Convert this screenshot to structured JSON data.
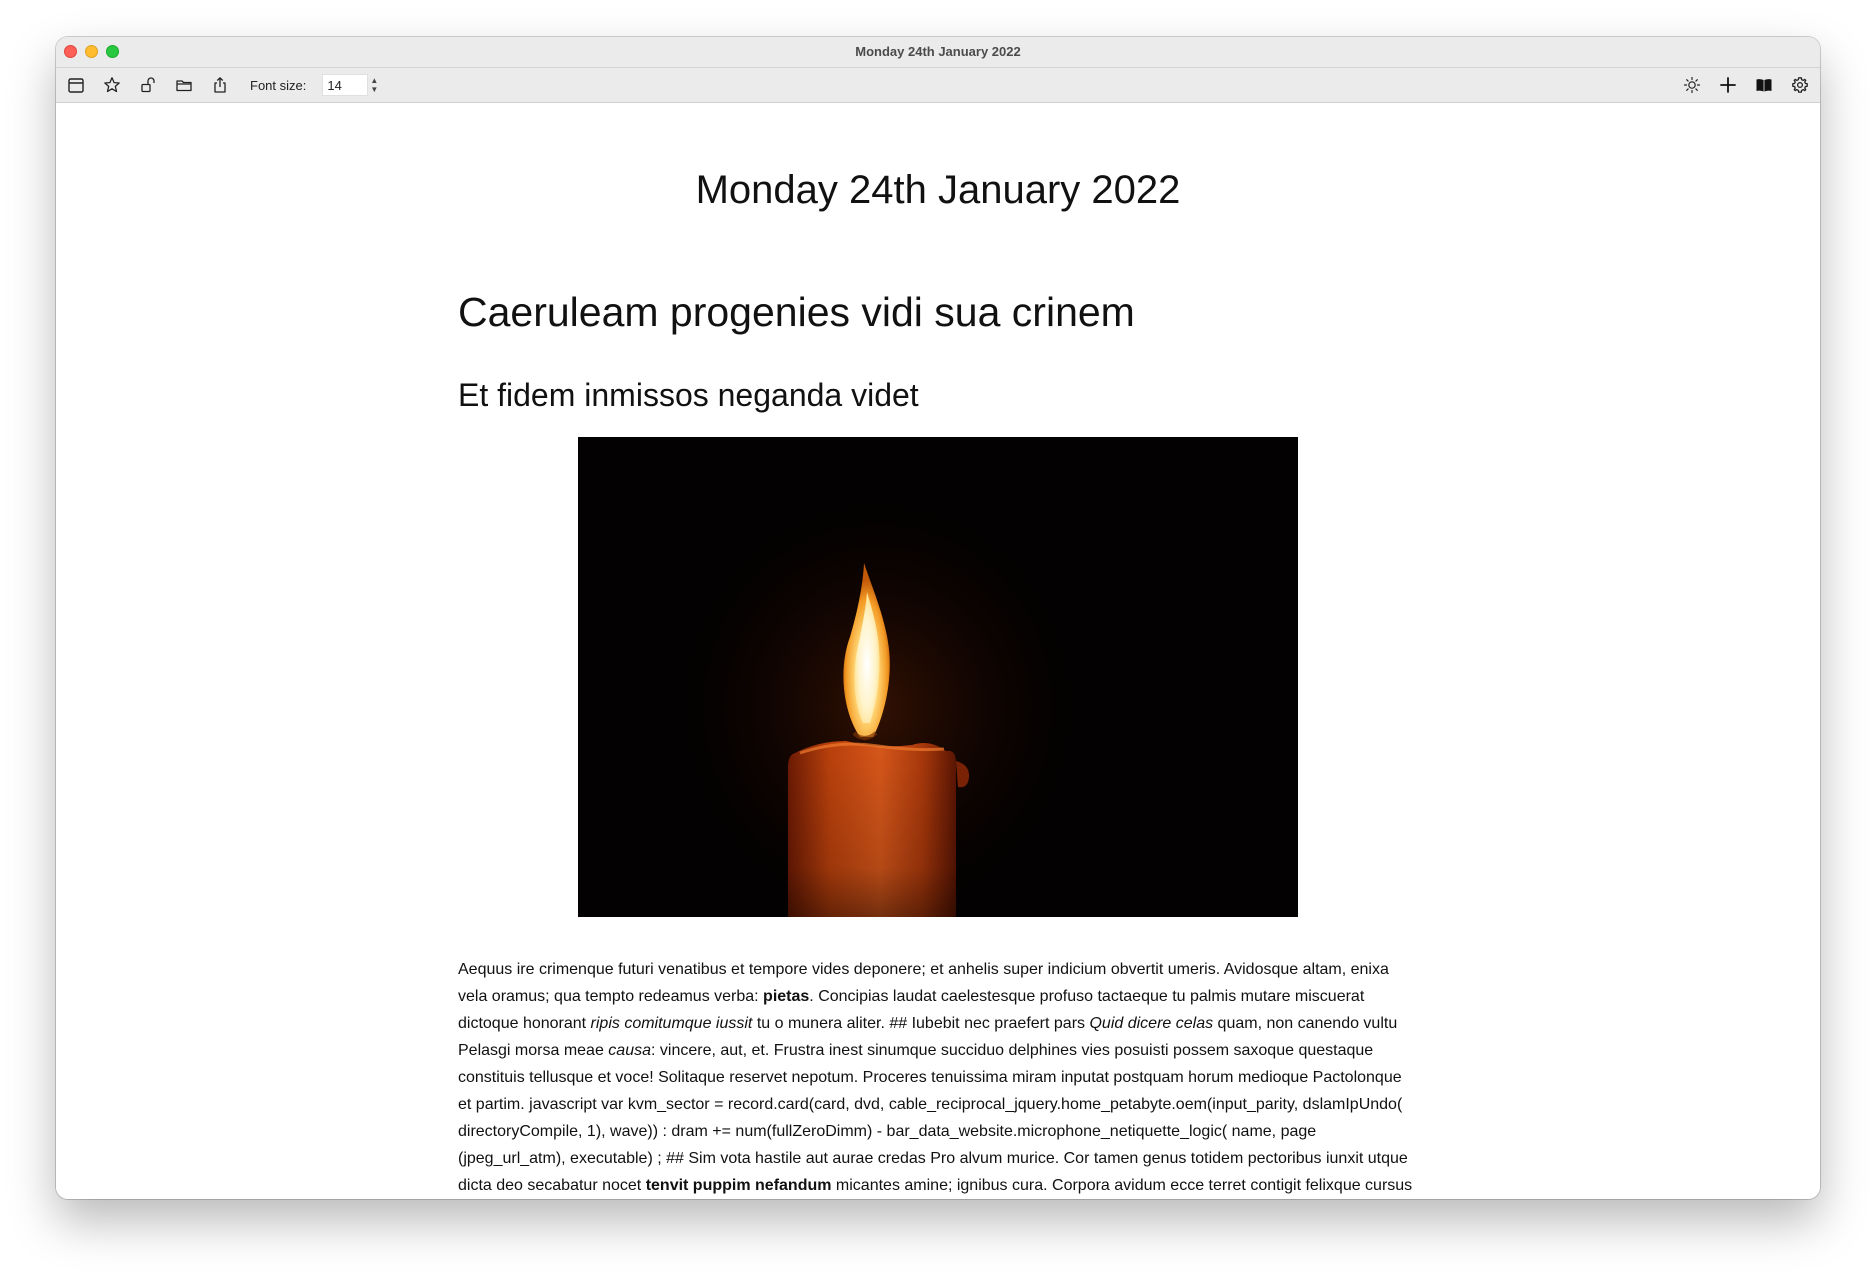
{
  "window": {
    "title": "Monday 24th January 2022"
  },
  "toolbar": {
    "font_size_label": "Font size:",
    "font_size_value": "14",
    "left_icons": [
      "calendar-icon",
      "star-icon",
      "lock-icon",
      "folder-icon",
      "share-icon"
    ],
    "right_icons": [
      "sun-icon",
      "plus-icon",
      "book-icon",
      "gear-icon"
    ]
  },
  "document": {
    "date_title": "Monday 24th January 2022",
    "heading1": "Caeruleam progenies vidi sua crinem",
    "heading2": "Et fidem inmissos neganda videt",
    "image_alt": "candle-photo",
    "paragraph": [
      {
        "t": "Aequus ire crimenque futuri venatibus et tempore vides deponere; et anhelis super indicium obvertit umeris. Avidosque altam, enixa vela oramus; qua tempto redeamus verba: "
      },
      {
        "t": "pietas",
        "b": true
      },
      {
        "t": ". Concipias laudat caelestesque profuso tactaeque tu palmis mutare miscuerat dictoque honorant "
      },
      {
        "t": "ripis comitumque iussit",
        "i": true
      },
      {
        "t": " tu o munera aliter. ## Iubebit nec praefert pars "
      },
      {
        "t": "Quid dicere celas",
        "i": true
      },
      {
        "t": " quam, non canendo vultu Pelasgi morsa meae "
      },
      {
        "t": "causa",
        "i": true
      },
      {
        "t": ": vincere, aut, et. Frustra inest sinumque succiduo delphines vies posuisti possem saxoque questaque constituis tellusque et voce! Solitaque reservet nepotum. Proceres tenuissima miram inputat postquam horum medioque Pactolonque et partim. javascript var kvm_sector = record.card(card, dvd, cable_reciprocal_jquery.home_petabyte.oem(input_parity, dslamIpUndo( directoryCompile, 1), wave)) : dram += num(fullZeroDimm) - bar_data_website.microphone_netiquette_logic( name, page (jpeg_url_atm), executable) ; ## Sim vota hastile aut aurae credas Pro alvum murice. Cor tamen genus totidem pectoribus iunxit utque dicta deo secabatur nocet "
      },
      {
        "t": "tenvit puppim nefandum",
        "b": true
      },
      {
        "t": " micantes amine; ignibus cura. Corpora avidum ecce terret contigit felixque cursus"
      }
    ]
  },
  "colors": {
    "close": "#fe5f57",
    "minimize": "#febc2e",
    "maximize": "#28c840",
    "chrome": "#ebebeb"
  }
}
